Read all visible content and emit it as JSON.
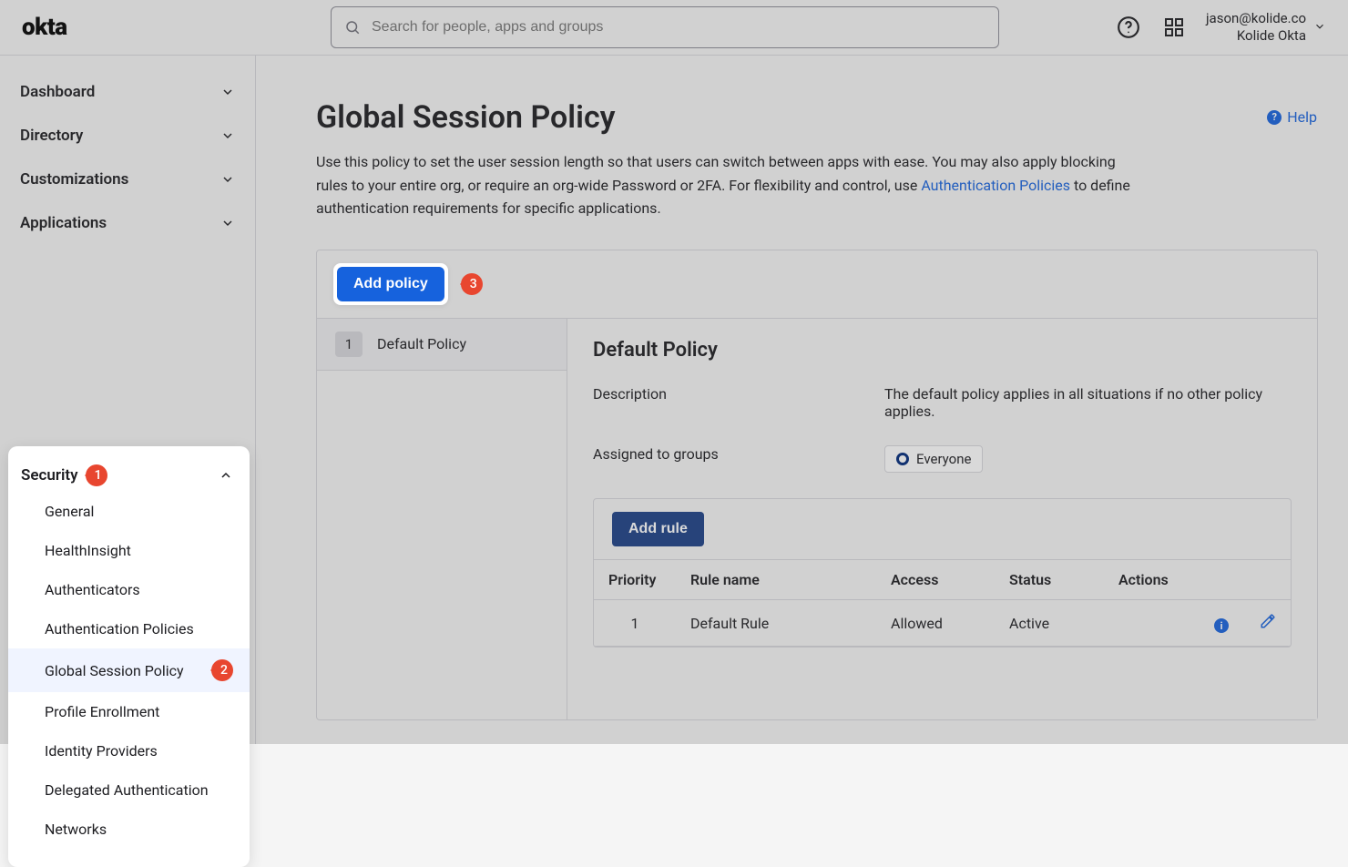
{
  "header": {
    "logo_text": "okta",
    "search_placeholder": "Search for people, apps and groups",
    "user_primary": "jason@kolide.co",
    "user_secondary": "Kolide Okta"
  },
  "sidebar": {
    "items": [
      {
        "label": "Dashboard"
      },
      {
        "label": "Directory"
      },
      {
        "label": "Customizations"
      },
      {
        "label": "Applications"
      }
    ],
    "security_label": "Security",
    "security_callout": "1",
    "sub_items": [
      {
        "label": "General"
      },
      {
        "label": "HealthInsight"
      },
      {
        "label": "Authenticators"
      },
      {
        "label": "Authentication Policies"
      },
      {
        "label": "Global Session Policy",
        "active": true,
        "callout": "2"
      },
      {
        "label": "Profile Enrollment"
      },
      {
        "label": "Identity Providers"
      },
      {
        "label": "Delegated Authentication"
      },
      {
        "label": "Networks"
      }
    ]
  },
  "page": {
    "title": "Global Session Policy",
    "help_label": "Help",
    "desc_part1": "Use this policy to set the user session length so that users can switch between apps with ease. You may also apply blocking rules to your entire org, or require an org-wide Password or 2FA. For flexibility and control, use ",
    "desc_link": "Authentication Policies",
    "desc_part2": " to define authentication requirements for specific applications.",
    "add_policy_button": "Add policy",
    "add_policy_callout": "3"
  },
  "policies": [
    {
      "rank": "1",
      "name": "Default Policy"
    }
  ],
  "policy_detail": {
    "title": "Default Policy",
    "description_label": "Description",
    "description_value": "The default policy applies in all situations if no other policy applies.",
    "groups_label": "Assigned to groups",
    "groups_chip": "Everyone",
    "add_rule_button": "Add rule",
    "columns": {
      "priority": "Priority",
      "rule_name": "Rule name",
      "access": "Access",
      "status": "Status",
      "actions": "Actions"
    },
    "rules": [
      {
        "priority": "1",
        "name": "Default Rule",
        "access": "Allowed",
        "status": "Active"
      }
    ]
  }
}
